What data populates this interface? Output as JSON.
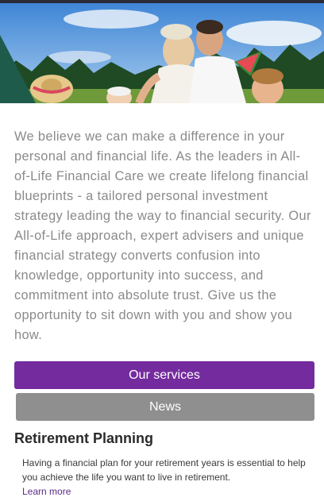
{
  "hero": {
    "image": "family-picnic-photo",
    "icons": [
      "photo-icon"
    ]
  },
  "intro": {
    "text": "We believe we can make a difference in your personal and financial life. As the leaders in All-of-Life Financial Care we create lifelong financial blueprints - a tailored personal investment strategy leading the way to financial security. Our All-of-Life approach, expert advisers and unique financial strategy converts confusion into knowledge, opportunity into success, and commitment into absolute trust. Give us the opportunity to sit down with you and show you how."
  },
  "buttons": {
    "services_label": "Our services",
    "news_label": "News"
  },
  "section": {
    "title": "Retirement Planning",
    "body": "Having a financial plan for your retirement years is essential to help you achieve the life you want to live in retirement.",
    "link": "Learn more"
  },
  "colors": {
    "primary": "#742b9e",
    "secondary": "#8f8f8f",
    "text_muted": "#8a8a8a",
    "link": "#5b2a86"
  }
}
